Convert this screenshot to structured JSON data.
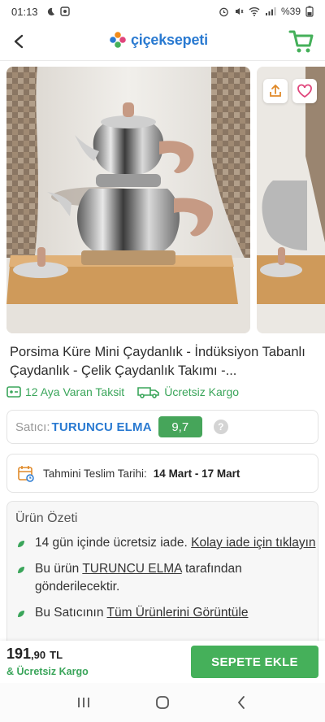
{
  "status": {
    "time": "01:13",
    "battery": "%39"
  },
  "header": {
    "logo_text": "çiçeksepeti"
  },
  "product": {
    "title": "Porsima Küre Mini Çaydanlık - İndüksiyon Tabanlı Çaydanlık - Çelik Çaydanlık Takımı -..."
  },
  "badges": {
    "installment": "12 Aya Varan Taksit",
    "free_shipping": "Ücretsiz Kargo"
  },
  "seller": {
    "label": "Satıcı:",
    "name": "TURUNCU ELMA",
    "rating": "9,7",
    "help": "?"
  },
  "delivery": {
    "label": "Tahmini Teslim Tarihi:",
    "value": "14 Mart - 17 Mart"
  },
  "summary": {
    "title": "Ürün Özeti",
    "item1_text": "14 gün içinde ücretsiz iade.",
    "item1_link": "Kolay iade için tıklayın",
    "item2_pre": "Bu ürün",
    "item2_link": "TURUNCU ELMA",
    "item2_post": "tarafından gönderilecektir.",
    "item3_pre": "Bu Satıcının",
    "item3_link": "Tüm Ürünlerini Görüntüle"
  },
  "bottom": {
    "price_int": "191",
    "price_dec": ",90",
    "currency": "TL",
    "shipping": "& Ücretsiz Kargo",
    "add_to_cart": "SEPETE EKLE"
  },
  "colors": {
    "brand_blue": "#2a7ad1",
    "accent_green": "#45b05a",
    "favorite_pink": "#e0457b"
  },
  "icons": [
    "back-arrow-icon",
    "cart-icon",
    "share-icon",
    "heart-icon",
    "installment-icon",
    "truck-icon",
    "calendar-icon",
    "leaf-bullet-icon",
    "recents-icon",
    "home-icon",
    "nav-back-icon"
  ]
}
